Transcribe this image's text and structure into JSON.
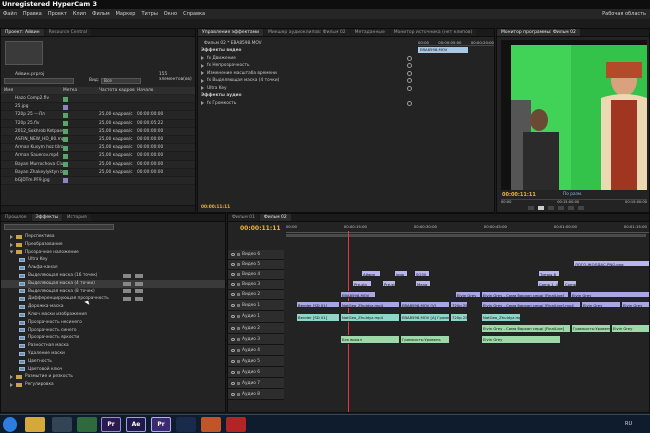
{
  "window": {
    "title": "Unregistered HyperCam 3"
  },
  "menu": [
    "Файл",
    "Правка",
    "Проект",
    "Клип",
    "Фильм",
    "Маркер",
    "Титры",
    "Окно",
    "Справка"
  ],
  "workspace": "Рабочая область",
  "project": {
    "tabs": [
      "Проект: Айвин",
      "Resource Central"
    ],
    "name": "Айвин.prproj",
    "count": "155 элементов(ов)",
    "in_label": "Вид:",
    "in_value": "Все",
    "columns": [
      "Имя",
      "Метка",
      "Частота кадров",
      "Начало медиа"
    ],
    "rows": [
      {
        "name": "Hazo Comp2.flv",
        "color": "#5aa46a",
        "fps": "",
        "start": ""
      },
      {
        "name": "25.jpg",
        "color": "#8f82c9",
        "fps": "",
        "start": ""
      },
      {
        "name": "720p 25 ---Лл",
        "color": "#5aa46a",
        "fps": "25,00 кадров/с",
        "start": "00:00:00:00"
      },
      {
        "name": "720p 25.flv",
        "color": "#5aa46a",
        "fps": "25,00 кадров/с",
        "start": "00:00:05:22"
      },
      {
        "name": "2012_Sokhrob Ketpaev - 2",
        "color": "#5aa46a",
        "fps": "25,00 кадров/с",
        "start": "00:00:00:00"
      },
      {
        "name": "ASFIN_NEW_HD_80.mp4",
        "color": "#5aa46a",
        "fps": "25,00 кадров/с",
        "start": "00:00:00:00"
      },
      {
        "name": "Arman Kusym hoz tilroo.m",
        "color": "#5aa46a",
        "fps": "25,00 кадров/с",
        "start": "00:00:00:00"
      },
      {
        "name": "Arman Sauerov.mp4",
        "color": "#5aa46a",
        "fps": "25,00 кадров/с",
        "start": "00:00:00:00"
      },
      {
        "name": "Bayan Murrochova Club_H",
        "color": "#5aa46a",
        "fps": "25,00 кадров/с",
        "start": "00:00:00:00"
      },
      {
        "name": "Bayan Zhakeylyktyn bafas",
        "color": "#5aa46a",
        "fps": "25,00 кадров/с",
        "start": "00:00:00:00"
      },
      {
        "name": "bGJDTm.PF9.jpg",
        "color": "#8f82c9",
        "fps": "",
        "start": ""
      }
    ]
  },
  "effect_controls": {
    "tabs": [
      "Управление эффектами",
      "Микшер аудиоклипов: Фильм 02",
      "Метаданные",
      "Монитор источника (нет клипов)"
    ],
    "clip_label": "Фильм 02 * EBA8598.MOV",
    "ruler": [
      "00:00",
      "00:00:05:00",
      "00:00:20:00"
    ],
    "clip_bar": "EBA8598.MOV",
    "sections": [
      {
        "label": "Эффекты видео",
        "kind": "header"
      },
      {
        "label": "fx  Движение",
        "kind": "effect"
      },
      {
        "label": "fx  Непрозрачность",
        "kind": "effect"
      },
      {
        "label": "Изменение масштаба времени",
        "kind": "effect"
      },
      {
        "label": "fx  Выделяющая маска (4 точки)",
        "kind": "effect"
      },
      {
        "label": "Ultra Key",
        "kind": "effect"
      },
      {
        "label": "Эффекты аудио",
        "kind": "header"
      },
      {
        "label": "fx  Громкость",
        "kind": "effect"
      }
    ],
    "timecode": "00:00:11:11"
  },
  "program_monitor": {
    "tab": "Монитор программы: Фильм 02",
    "timecode": "00:00:11:11",
    "fit": "По разм.",
    "ruler": [
      "00:00",
      "00:15:00:00",
      "00:15:00:00"
    ]
  },
  "effects": {
    "tabs": [
      "Прошлое",
      "Эффекты",
      "История"
    ],
    "items": [
      {
        "label": "Перспектива",
        "level": 1,
        "folder": true
      },
      {
        "label": "Преобразование",
        "level": 1,
        "folder": true
      },
      {
        "label": "Прозрачное наложение",
        "level": 1,
        "folder": true,
        "open": true
      },
      {
        "label": "Ultra Key",
        "level": 2
      },
      {
        "label": "Альфа-канал",
        "level": 2
      },
      {
        "label": "Выделяющая маска (16 точек)",
        "level": 2
      },
      {
        "label": "Выделяющая маска (4 точки)",
        "level": 2
      },
      {
        "label": "Выделяющая маска (8 точек)",
        "level": 2
      },
      {
        "label": "Дифференцирующая прозрачность",
        "level": 2
      },
      {
        "label": "Дорожка-маска",
        "level": 2
      },
      {
        "label": "Ключ маски изображения",
        "level": 2
      },
      {
        "label": "Прозрачность несинего",
        "level": 2
      },
      {
        "label": "Прозрачность синего",
        "level": 2
      },
      {
        "label": "Прозрачность яркости",
        "level": 2
      },
      {
        "label": "Разностная маска",
        "level": 2
      },
      {
        "label": "Удаление маски",
        "level": 2
      },
      {
        "label": "Цветность",
        "level": 2
      },
      {
        "label": "Цветовой ключ",
        "level": 2
      },
      {
        "label": "Размытие и резкость",
        "level": 1,
        "folder": true
      },
      {
        "label": "Регулировка",
        "level": 1,
        "folder": true
      }
    ]
  },
  "timeline": {
    "tabs": [
      "Фильм 01",
      "Фильм 02"
    ],
    "timecode": "00:00:11:11",
    "ruler": [
      "00:00",
      "00:00:15:00",
      "00:00:30:00",
      "00:00:45:00",
      "00:01:00:00",
      "00:01:15:00"
    ],
    "tracks": [
      {
        "label": "Видео 6",
        "type": "v"
      },
      {
        "label": "Видео 5",
        "type": "v"
      },
      {
        "label": "Видео 4",
        "type": "v"
      },
      {
        "label": "Видео 3",
        "type": "v"
      },
      {
        "label": "Видео 2",
        "type": "v"
      },
      {
        "label": "Видео 1",
        "type": "v"
      },
      {
        "label": "Аудио 1",
        "type": "a"
      },
      {
        "label": "Аудио 2",
        "type": "a"
      },
      {
        "label": "Аудио 3",
        "type": "a"
      },
      {
        "label": "Аудио 4",
        "type": "a"
      },
      {
        "label": "Аудио 5",
        "type": "a"
      },
      {
        "label": "Аудио 6",
        "type": "a"
      },
      {
        "label": "Аудио 7",
        "type": "a"
      },
      {
        "label": "Аудио 8",
        "type": "a"
      }
    ],
    "clip_labels": {
      "c1": "Айвин",
      "c2": "logo",
      "c3": "SQ30",
      "c4": "Титры 8",
      "c5": "ЛОГО-ЖОЛДАС-PNG.png",
      "c6": "Pre-sty",
      "c7": "Pre-sty",
      "c8": "Mang",
      "c9": "Comp 1_4",
      "c10": "Comp 1_30",
      "c11": "EBA8598.MOV",
      "c12": "Elvin Grey",
      "c13": "Elvin Grey - Сама бархан серді [FinalLive]",
      "c14": "Elvin Grey",
      "c15": "Bender [SD 01]",
      "c16": "NatGeo_Zhuldyz.mp4",
      "c17": "EBA8598.MOV [V]",
      "c18": "720p 25.flv",
      "c19": "Elvin Grey - Сама бархан серді [FinalLive].mp4",
      "c20": "Elvin Grey",
      "c21": "Elvin Grey",
      "c22": "Bender [SD 01]",
      "c23": "NatGeo_Zhuldyz.mp4",
      "c24": "EBA8598.MOV [A]  Громкость:Уровень",
      "c25": "720p 25.flv",
      "c26": "NatGeo_Zhuldyz.mp4 [A]",
      "c27": "Elvin Grey - Сама бархан серді [FinalLive]",
      "c28": "Громкость:Уровень",
      "c29": "Elvin Grey",
      "c30": "Elvin Grey",
      "c31": "Бэк вокал",
      "c32": "Громкость:Уровень"
    }
  },
  "taskbar": {
    "lang": "RU"
  }
}
